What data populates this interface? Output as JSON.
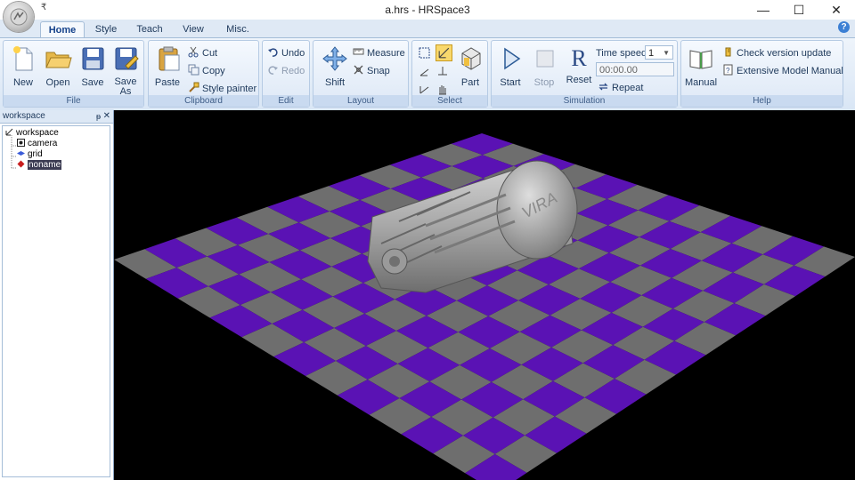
{
  "window": {
    "title": "a.hrs - HRSpace3",
    "qat_symbol": "₹"
  },
  "controls": {
    "minimize": "—",
    "maximize": "☐",
    "close": "✕"
  },
  "tabs": [
    {
      "label": "Home",
      "active": true
    },
    {
      "label": "Style"
    },
    {
      "label": "Teach"
    },
    {
      "label": "View"
    },
    {
      "label": "Misc."
    }
  ],
  "help_symbol": "?",
  "ribbon": {
    "file": {
      "label": "File",
      "new": "New",
      "open": "Open",
      "save": "Save",
      "save_as": "Save As"
    },
    "clipboard": {
      "label": "Clipboard",
      "paste": "Paste",
      "cut": "Cut",
      "copy": "Copy",
      "style_painter": "Style painter"
    },
    "edit": {
      "label": "Edit",
      "undo": "Undo",
      "redo": "Redo"
    },
    "layout": {
      "label": "Layout",
      "shift": "Shift",
      "measure": "Measure",
      "snap": "Snap"
    },
    "select": {
      "label": "Select",
      "part": "Part"
    },
    "simulation": {
      "label": "Simulation",
      "start": "Start",
      "stop": "Stop",
      "reset": "Reset",
      "reset_glyph": "R",
      "time_speed_label": "Time speed",
      "time_speed_value": "1",
      "time_value": "00:00.00",
      "repeat": "Repeat"
    },
    "help": {
      "label": "Help",
      "manual": "Manual",
      "check_version": "Check version update",
      "extensive_manual": "Extensive Model Manual"
    }
  },
  "workspace": {
    "title": "workspace",
    "pin": "ᵽ",
    "close": "✕",
    "tree": {
      "root": "workspace",
      "items": [
        "camera",
        "grid",
        "noname"
      ],
      "selected": "noname"
    }
  },
  "viewport": {
    "background": "#000000",
    "checker_colors": [
      "#5a12b4",
      "#6e6e6e"
    ],
    "model_label": "VIRA"
  }
}
